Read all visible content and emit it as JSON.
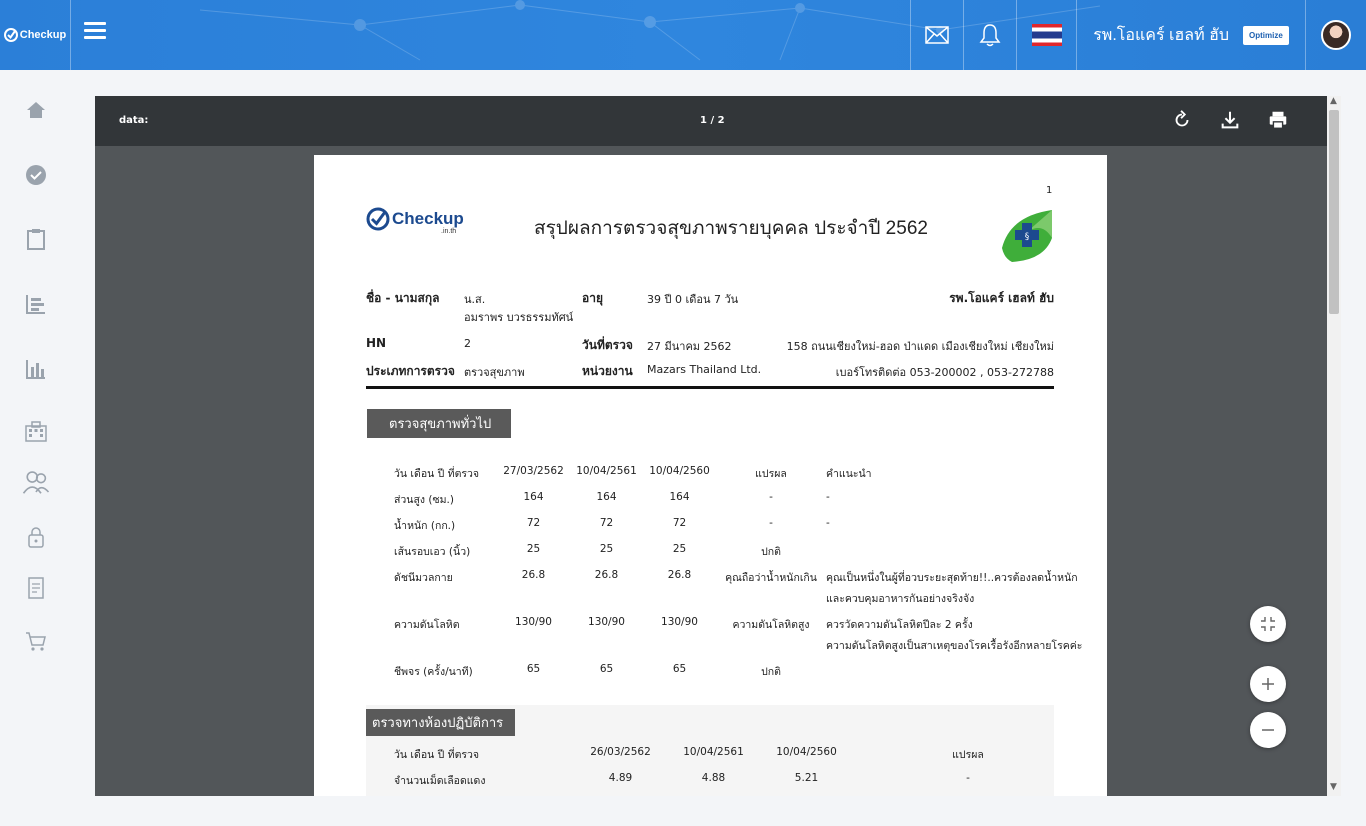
{
  "header": {
    "brand_logo": "Checkup",
    "brand_sub": ".in.th",
    "hospital_name": "รพ.โอแคร์ เฮลท์ ฮับ",
    "partner_logo": "Optimize",
    "icons": [
      "mail-icon",
      "bell-icon",
      "thai-flag-icon",
      "avatar"
    ]
  },
  "sidebar": {
    "items": [
      "home-icon",
      "check-circle-icon",
      "clipboard-icon",
      "list-chart-icon",
      "bar-chart-icon",
      "building-icon",
      "users-icon",
      "lock-icon",
      "document-icon",
      "cart-icon"
    ]
  },
  "viewer": {
    "title": "data:",
    "page_indicator": "1 / 2",
    "toolbar_icons": [
      "rotate-icon",
      "download-icon",
      "print-icon"
    ]
  },
  "report": {
    "page_number": "1",
    "logo_text": "Checkup",
    "logo_sub": ".in.th",
    "title": "สรุปผลการตรวจสุขภาพรายบุคคล ประจำปี 2562",
    "name_label": "ชื่อ - นามสกุล",
    "name_value_1": "น.ส.",
    "name_value_2": "อมราพร บวรธรรมทัศน์",
    "age_label": "อายุ",
    "age_value": "39 ปี 0 เดือน 7 วัน",
    "hospital": "รพ.โอแคร์ เฮลท์ ฮับ",
    "hn_label": "HN",
    "hn_value": "2",
    "date_label": "วันที่ตรวจ",
    "date_value": "27 มีนาคม 2562",
    "address": "158 ถนนเชียงใหม่-ฮอด  ป่าแดด เมืองเชียงใหม่ เชียงใหม่",
    "type_label": "ประเภทการตรวจ",
    "type_value": "ตรวจสุขภาพ",
    "unit_label": "หน่วยงาน",
    "unit_value": "Mazars Thailand Ltd.",
    "phone": "เบอร์โทรติดต่อ  053-200002 , 053-272788",
    "general_section": "ตรวจสุขภาพทั่วไป",
    "general_headers": [
      "วัน เดือน ปี ที่ตรวจ",
      "27/03/2562",
      "10/04/2561",
      "10/04/2560",
      "แปรผล",
      "คำแนะนำ"
    ],
    "general_rows": [
      [
        "ส่วนสูง (ซม.)",
        "164",
        "164",
        "164",
        "-",
        "-"
      ],
      [
        "น้ำหนัก (กก.)",
        "72",
        "72",
        "72",
        "-",
        "-"
      ],
      [
        "เส้นรอบเอว (นิ้ว)",
        "25",
        "25",
        "25",
        "ปกติ",
        ""
      ],
      [
        "ดัชนีมวลกาย",
        "26.8",
        "26.8",
        "26.8",
        "คุณถือว่าน้ำหนักเกิน",
        "คุณเป็นหนึ่งในผู้ที่อวบระยะสุดท้าย!!..ควรต้องลดน้ำหนัก"
      ],
      [
        "",
        "",
        "",
        "",
        "",
        "และควบคุมอาหารกันอย่างจริงจัง"
      ],
      [
        "ความดันโลหิต",
        "130/90",
        "130/90",
        "130/90",
        "ความดันโลหิตสูง",
        "ควรวัดความดันโลหิตปีละ 2 ครั้ง"
      ],
      [
        "",
        "",
        "",
        "",
        "",
        "ความดันโลหิตสูงเป็นสาเหตุของโรคเรื้อรังอีกหลายโรคค่ะ"
      ],
      [
        "ชีพจร (ครั้ง/นาที)",
        "65",
        "65",
        "65",
        "ปกติ",
        ""
      ]
    ],
    "lab_section": "ตรวจทางห้องปฏิบัติการ",
    "lab_headers": [
      "วัน เดือน ปี ที่ตรวจ",
      "26/03/2562",
      "10/04/2561",
      "10/04/2560",
      "แปรผล"
    ],
    "lab_rows": [
      [
        "จำนวนเม็ดเลือดแดง",
        "4.89",
        "4.88",
        "5.21",
        "-"
      ]
    ]
  },
  "controls": {
    "icons": [
      "fit-screen-icon",
      "zoom-in-icon",
      "zoom-out-icon"
    ]
  }
}
